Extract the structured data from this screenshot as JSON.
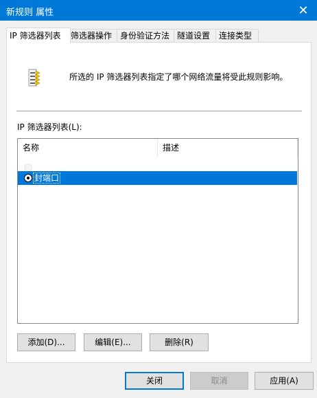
{
  "window": {
    "title": "新规则 属性",
    "close_glyph": "✕"
  },
  "tabs": [
    {
      "label": "IP 筛选器列表",
      "active": true
    },
    {
      "label": "筛选器操作",
      "active": false
    },
    {
      "label": "身份验证方法",
      "active": false
    },
    {
      "label": "隧道设置",
      "active": false
    },
    {
      "label": "连接类型",
      "active": false
    }
  ],
  "panel": {
    "icon": "filter-list-icon",
    "description": "所选的 IP 筛选器列表指定了哪个网络流量将受此规则影响。",
    "list_label": "IP 筛选器列表(L):",
    "columns": [
      "名称",
      "描述"
    ],
    "rows": [
      {
        "name": "封端口",
        "description": "",
        "selected": true
      }
    ],
    "buttons": {
      "add": "添加(D)...",
      "edit": "编辑(E)...",
      "delete": "删除(R)"
    }
  },
  "footer": {
    "close": "关闭",
    "cancel": "取消",
    "apply": "应用(A)"
  },
  "colors": {
    "accent": "#0078d7",
    "selection": "#0078d7"
  }
}
